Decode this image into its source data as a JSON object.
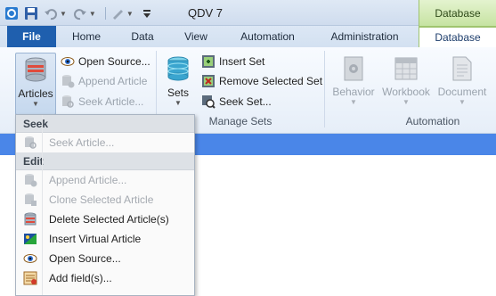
{
  "window": {
    "title": "QDV 7",
    "context_tab_group": "Database"
  },
  "tabs": [
    {
      "label": "File"
    },
    {
      "label": "Home"
    },
    {
      "label": "Data"
    },
    {
      "label": "View"
    },
    {
      "label": "Automation"
    },
    {
      "label": "Administration"
    },
    {
      "label": "Database"
    }
  ],
  "ribbon": {
    "articles": {
      "label": "Articles"
    },
    "open_source": "Open Source...",
    "append_article": "Append Article",
    "seek_article": "Seek Article...",
    "sets": {
      "label": "Sets"
    },
    "insert_set": "Insert Set",
    "remove_selected_set": "Remove Selected Set",
    "seek_set": "Seek Set...",
    "manage_sets_group": "Manage Sets",
    "behavior": "Behavior",
    "workbook": "Workbook",
    "document": "Document",
    "automation_group": "Automation"
  },
  "menu": {
    "seek_header": "Seek",
    "seek_article": "Seek Article...",
    "edit_header": "Edit",
    "append_article": "Append Article...",
    "clone_selected_article": "Clone Selected Article",
    "delete_selected_articles": "Delete Selected Article(s)",
    "insert_virtual_article": "Insert Virtual Article",
    "open_source": "Open Source...",
    "add_fields": "Add field(s)..."
  }
}
